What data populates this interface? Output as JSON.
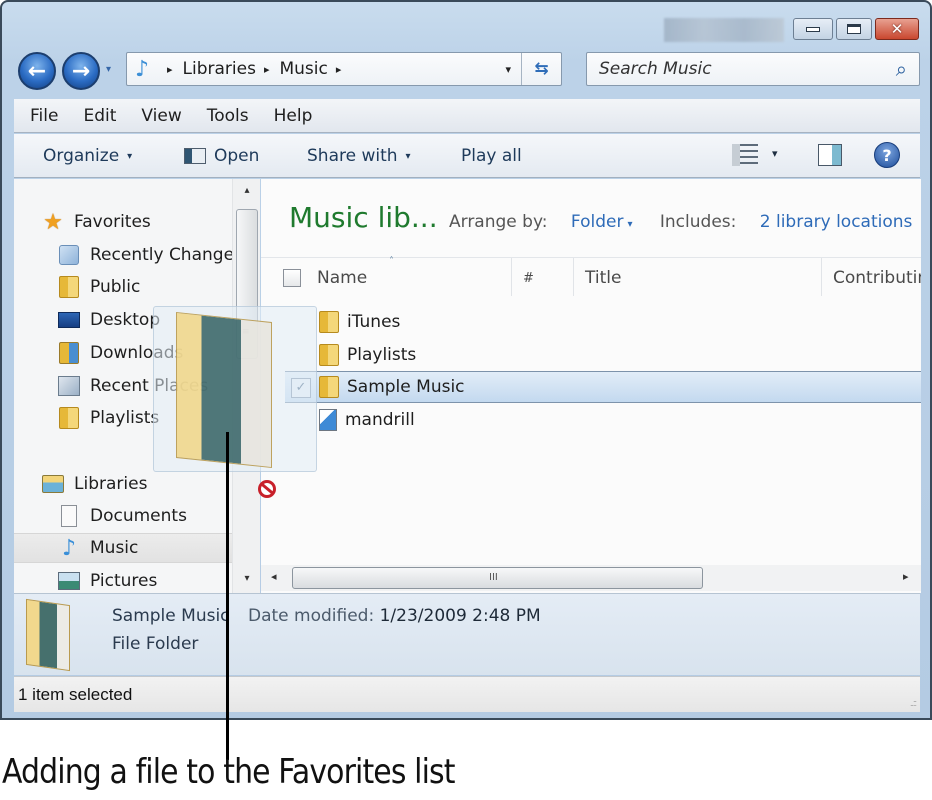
{
  "window": {
    "controls": {
      "minimize": "minimize",
      "maximize": "maximize",
      "close": "✕"
    }
  },
  "nav": {
    "back_icon": "←",
    "forward_icon": "→",
    "history_dropdown_icon": "▾",
    "address": {
      "breadcrumbs": [
        "Libraries",
        "Music"
      ],
      "separator": "▸",
      "location_icon": "♪",
      "dropdown_icon": "▾",
      "refresh_icon": "⇆"
    },
    "search": {
      "placeholder": "Search Music",
      "icon": "⌕"
    }
  },
  "menubar": {
    "items": [
      "File",
      "Edit",
      "View",
      "Tools",
      "Help"
    ]
  },
  "commandbar": {
    "organize": "Organize",
    "open": "Open",
    "share_with": "Share with",
    "play_all": "Play all",
    "dropdown_icon": "▾",
    "help_icon": "?"
  },
  "navpane": {
    "favorites": {
      "label": "Favorites",
      "items": [
        "Recently Change",
        "Public",
        "Desktop",
        "Downloads",
        "Recent Places",
        "Playlists"
      ]
    },
    "libraries": {
      "label": "Libraries",
      "items": [
        "Documents",
        "Music",
        "Pictures"
      ],
      "selected": "Music"
    },
    "scroll_up": "▴",
    "scroll_down": "▾",
    "grip": "≡"
  },
  "content": {
    "library_title": "Music lib...",
    "arrange_by_label": "Arrange by:",
    "arrange_by_value": "Folder",
    "includes_label": "Includes:",
    "includes_value": "2 library locations",
    "columns": [
      "Name",
      "#",
      "Title",
      "Contributin"
    ],
    "sort_indicator": "˄",
    "rows": [
      {
        "name": "iTunes",
        "type": "folder",
        "selected": false
      },
      {
        "name": "Playlists",
        "type": "folder",
        "selected": false
      },
      {
        "name": "Sample Music",
        "type": "folder",
        "selected": true
      },
      {
        "name": "mandrill",
        "type": "audio-file",
        "selected": false
      }
    ],
    "check_mark": "✓",
    "hscroll": {
      "left": "◂",
      "right": "▸",
      "grip": "III"
    }
  },
  "details": {
    "name": "Sample Music",
    "type": "File Folder",
    "date_label": "Date modified:",
    "date_value": "1/23/2009 2:48 PM"
  },
  "statusbar": {
    "text": "1 item selected",
    "grip": "..::"
  },
  "caption": "Adding a file to the Favorites list"
}
